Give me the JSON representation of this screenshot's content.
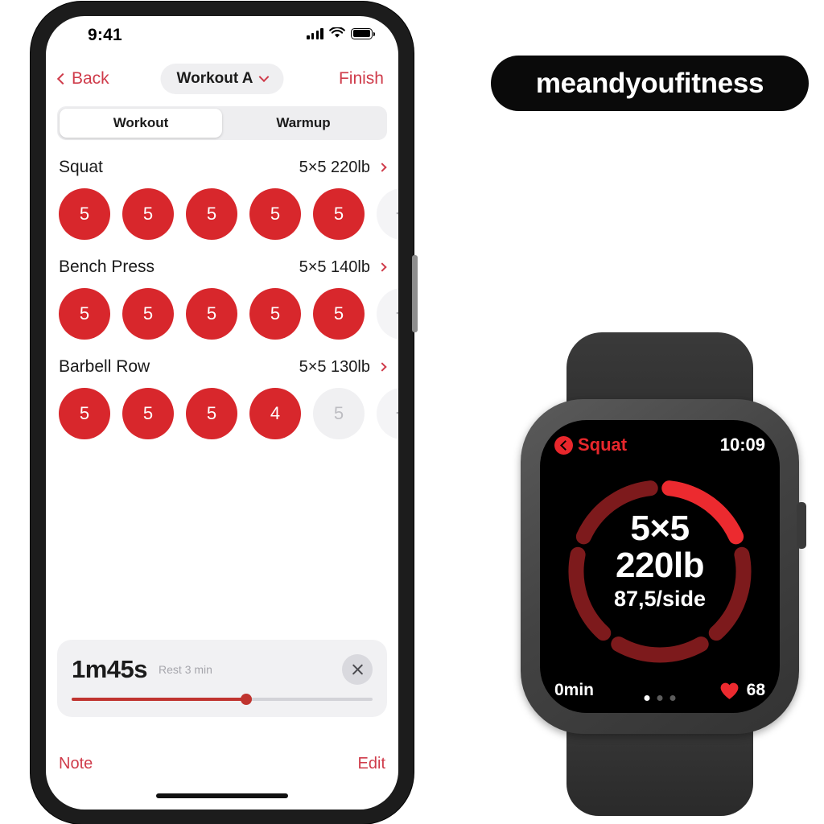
{
  "phone": {
    "status_bar": {
      "time": "9:41",
      "signal_icon": "cellular-bars-icon",
      "wifi_icon": "wifi-icon",
      "battery_icon": "battery-full-icon"
    },
    "nav": {
      "back_label": "Back",
      "back_icon": "chevron-left-icon",
      "title": "Workout A",
      "title_chevron_icon": "chevron-down-icon",
      "finish_label": "Finish"
    },
    "tabs": [
      {
        "label": "Workout",
        "active": true
      },
      {
        "label": "Warmup",
        "active": false
      }
    ],
    "exercises": [
      {
        "name": "Squat",
        "meta": "5×5 220lb",
        "chevron_icon": "chevron-right-icon",
        "sets": [
          {
            "value": "5",
            "state": "done"
          },
          {
            "value": "5",
            "state": "done"
          },
          {
            "value": "5",
            "state": "done"
          },
          {
            "value": "5",
            "state": "done"
          },
          {
            "value": "5",
            "state": "done"
          },
          {
            "value": "+",
            "state": "add"
          }
        ]
      },
      {
        "name": "Bench Press",
        "meta": "5×5 140lb",
        "chevron_icon": "chevron-right-icon",
        "sets": [
          {
            "value": "5",
            "state": "done"
          },
          {
            "value": "5",
            "state": "done"
          },
          {
            "value": "5",
            "state": "done"
          },
          {
            "value": "5",
            "state": "done"
          },
          {
            "value": "5",
            "state": "done"
          },
          {
            "value": "+",
            "state": "add"
          }
        ]
      },
      {
        "name": "Barbell Row",
        "meta": "5×5 130lb",
        "chevron_icon": "chevron-right-icon",
        "sets": [
          {
            "value": "5",
            "state": "done"
          },
          {
            "value": "5",
            "state": "done"
          },
          {
            "value": "5",
            "state": "done"
          },
          {
            "value": "4",
            "state": "done"
          },
          {
            "value": "5",
            "state": "empty"
          },
          {
            "value": "+",
            "state": "add"
          }
        ]
      }
    ],
    "rest_timer": {
      "remaining": "1m45s",
      "label": "Rest 3 min",
      "close_icon": "close-icon",
      "progress_percent": 58
    },
    "bottom_actions": {
      "note_label": "Note",
      "edit_label": "Edit"
    }
  },
  "logo": {
    "text": "meandyoufitness"
  },
  "watch": {
    "back_label": "Squat",
    "back_icon": "back-circle-icon",
    "time": "10:09",
    "reps": "5×5",
    "weight": "220lb",
    "per_side": "87,5/side",
    "elapsed": "0min",
    "heart_icon": "heart-icon",
    "heart_rate": "68",
    "page_dots": [
      true,
      false,
      false
    ],
    "ring": {
      "total_segments": 5,
      "completed_segments": 1,
      "active_color": "#ec2a2f",
      "inactive_color": "#7d1a1c"
    }
  }
}
